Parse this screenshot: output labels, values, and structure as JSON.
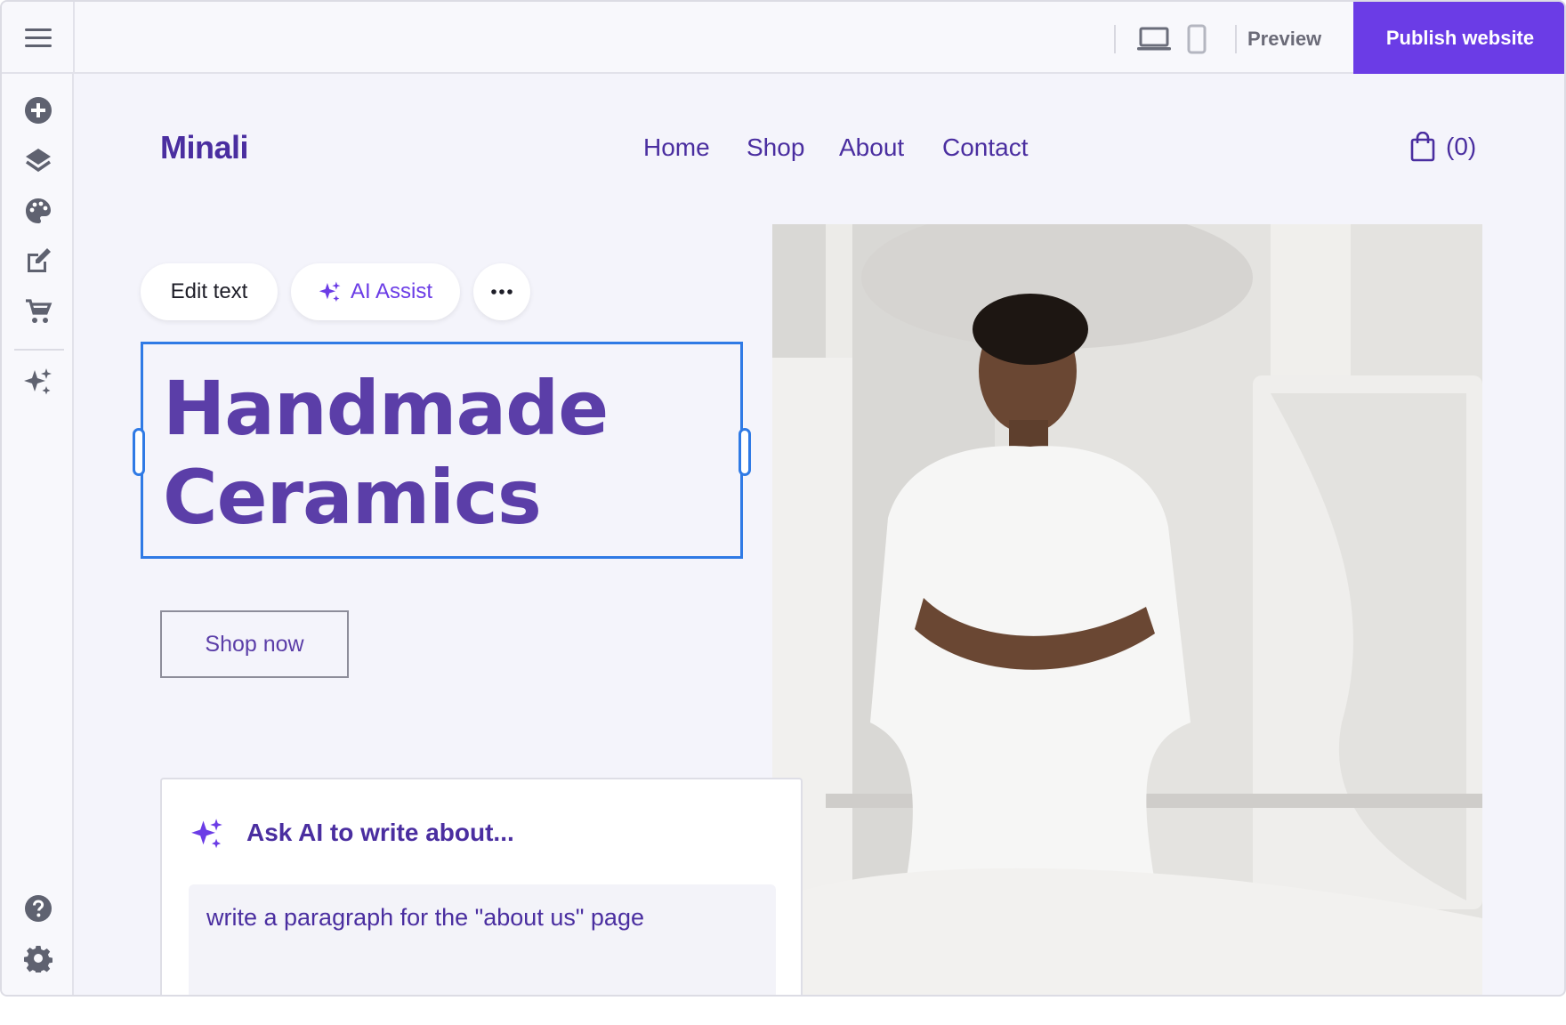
{
  "topbar": {
    "preview_label": "Preview",
    "publish_label": "Publish website"
  },
  "sidebar": {
    "items": [
      {
        "icon": "add-icon"
      },
      {
        "icon": "layers-icon"
      },
      {
        "icon": "palette-icon"
      },
      {
        "icon": "edit-icon"
      },
      {
        "icon": "cart-icon"
      },
      {
        "icon": "sparkles-icon"
      },
      {
        "icon": "help-icon"
      },
      {
        "icon": "settings-icon"
      }
    ]
  },
  "site": {
    "logo": "Minali",
    "nav": [
      "Home",
      "Shop",
      "About",
      "Contact"
    ],
    "cart_count": "(0)",
    "headline_line1": "Handmade",
    "headline_line2": "Ceramics",
    "cta_label": "Shop now"
  },
  "toolbar": {
    "edit_text_label": "Edit text",
    "ai_assist_label": "AI Assist"
  },
  "ai_panel": {
    "title": "Ask AI to write about...",
    "input_value": "write a paragraph for the \"about us\" page"
  },
  "colors": {
    "accent": "#6b3ce6",
    "brand_text": "#4a2ea0",
    "selection": "#2f7ae5",
    "canvas_bg": "#f4f4fb"
  }
}
